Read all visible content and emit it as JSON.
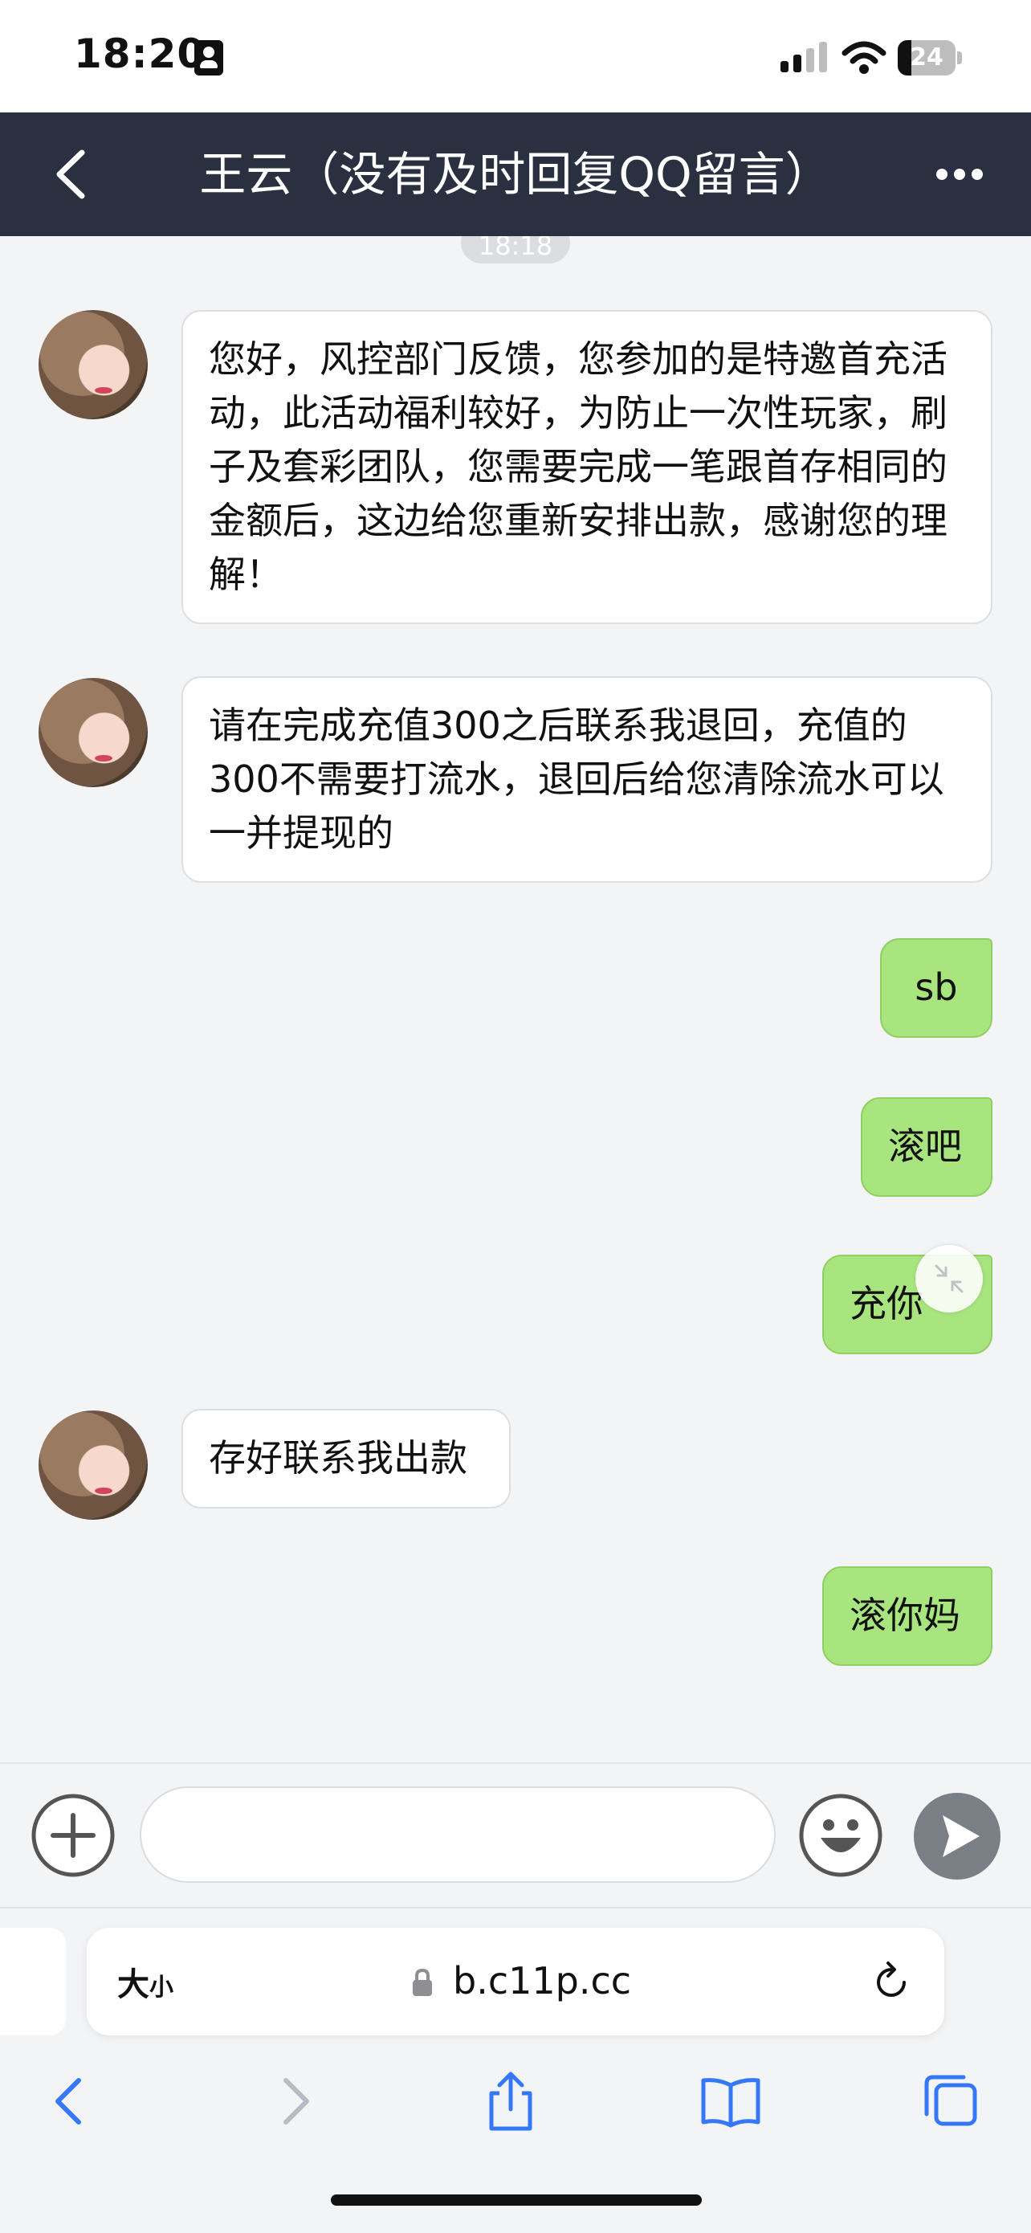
{
  "status_bar": {
    "time": "18:20",
    "battery": "24",
    "battery_level": 0.24
  },
  "header": {
    "back_icon": "chevron-left-icon",
    "title": "王云（没有及时回复QQ留言）",
    "more_icon": "ellipsis-icon"
  },
  "chat": {
    "timestamp": "18:18",
    "messages": [
      {
        "direction": "incoming",
        "text": "您好，风控部门反馈，您参加的是特邀首充活动，此活动福利较好，为防止一次性玩家，刷子及套彩团队，您需要完成一笔跟首存相同的金额后，这边给您重新安排出款，感谢您的理解！"
      },
      {
        "direction": "incoming",
        "text": "请在完成充值300之后联系我退回，充值的300不需要打流水，退回后给您清除流水可以一并提现的"
      },
      {
        "direction": "outgoing",
        "text": "sb"
      },
      {
        "direction": "outgoing",
        "text": "滚吧"
      },
      {
        "direction": "outgoing",
        "text": "充你"
      },
      {
        "direction": "incoming",
        "text": "存好联系我出款"
      },
      {
        "direction": "outgoing",
        "text": "滚你妈"
      }
    ]
  },
  "input_bar": {
    "plus_icon": "plus-circle-icon",
    "placeholder": "",
    "emoji_icon": "smile-face-icon",
    "send_icon": "send-icon"
  },
  "browser": {
    "text_size_label": "大",
    "text_size_small": "小",
    "url": "b.c11p.cc",
    "toolbar_icons": [
      "back-icon",
      "forward-icon",
      "share-icon",
      "bookmarks-icon",
      "tabs-icon"
    ]
  },
  "colors": {
    "nav_background": "#2b3040",
    "outgoing_bubble": "#a9e57f",
    "incoming_bubble": "#ffffff",
    "safari_blue": "#3478f6"
  }
}
